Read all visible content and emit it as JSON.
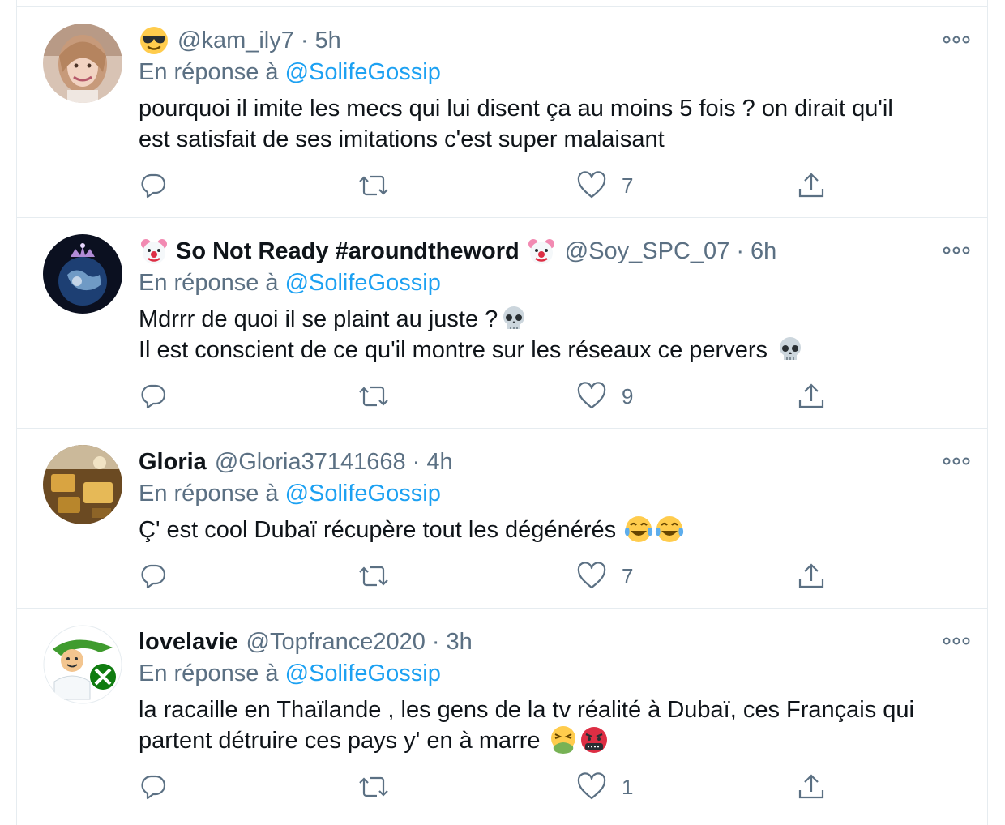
{
  "colors": {
    "link": "#1da1f2",
    "muted": "#5b7083",
    "text": "#0f1419",
    "divider": "#e6ecf0"
  },
  "reply_prefix": "En réponse à",
  "tweets": [
    {
      "name": "",
      "handle": "@kam_ily7",
      "separator": "·",
      "time": "5h",
      "name_prefix_emoji": "sunglasses-emoji",
      "reply_prefix": "En réponse à",
      "reply_to": "@SolifeGossip",
      "lines": [
        "pourquoi il imite les mecs qui lui disent ça au moins 5 fois ? on dirait qu'il",
        "est satisfait de ses imitations c'est super malaisant"
      ],
      "likes": "7",
      "avatar": "woman-portrait"
    },
    {
      "name": "So Not Ready #aroundtheword",
      "handle": "@Soy_SPC_07",
      "separator": "·",
      "time": "6h",
      "name_emojis": [
        "clown-emoji",
        "clown-emoji"
      ],
      "reply_prefix": "En réponse à",
      "reply_to": "@SolifeGossip",
      "lines": [
        "Mdrrr de quoi il se plaint au juste ?",
        "Il est conscient de ce qu'il montre sur les réseaux ce pervers"
      ],
      "line_emojis": [
        "skull-emoji",
        "skull-emoji"
      ],
      "likes": "9",
      "avatar": "earth-crown"
    },
    {
      "name": "Gloria",
      "handle": "@Gloria37141668",
      "separator": "·",
      "time": "4h",
      "reply_prefix": "En réponse à",
      "reply_to": "@SolifeGossip",
      "lines": [
        "Ç' est cool Dubaï récupère tout les dégénérés"
      ],
      "line_emojis": [
        "tears-of-joy-emoji",
        "tears-of-joy-emoji"
      ],
      "likes": "7",
      "avatar": "gold-items"
    },
    {
      "name": "lovelavie",
      "handle": "@Topfrance2020",
      "separator": "·",
      "time": "3h",
      "reply_prefix": "En réponse à",
      "reply_to": "@SolifeGossip",
      "lines": [
        "la racaille en Thaïlande , les gens de la tv réalité à Dubaï, ces Français qui",
        "partent détruire ces pays y' en à marre"
      ],
      "line_emojis": [
        "vomiting-emoji",
        "cursing-emoji"
      ],
      "likes": "1",
      "avatar": "cartoon-xbox"
    }
  ]
}
